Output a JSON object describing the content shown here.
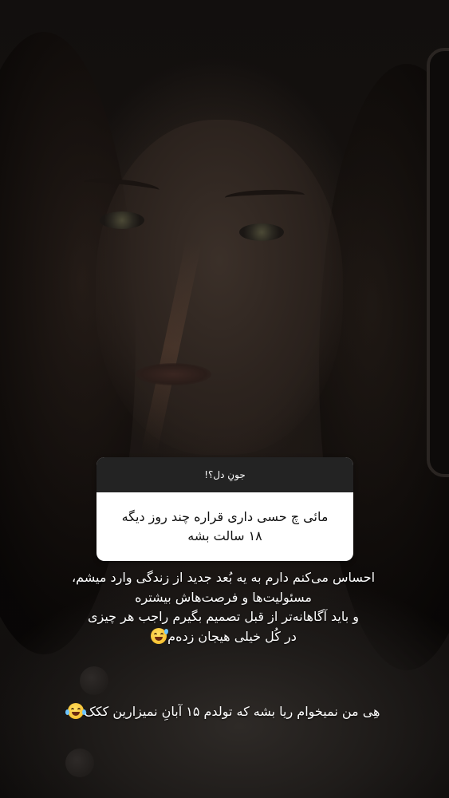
{
  "question_sticker": {
    "header": "جونِ دل؟!",
    "question": "مائی چ حسی داری قراره چند روز دیگه ۱۸ سالت بشه"
  },
  "answer": {
    "lines": [
      "احساس می‌کنم دارم به یه بُعد جدید از زندگی وارد میشم،",
      "مسئولیت‌ها و فرصت‌هاش بیشتره",
      "و باید آگاهانه‌تر از قبل تصمیم بگیرم راجب هر چیزی",
      "در کُل خیلی هیجان زدەم"
    ],
    "emoji": "grinning-sweat-emoji"
  },
  "footer": {
    "text": "هِی من نمیخوام ریا بشه که تولدم ۱۵ آبانِ نمیزارین ککک",
    "emoji": "tears-of-joy-emoji"
  },
  "colors": {
    "sticker_header_bg": "#232323",
    "sticker_body_bg": "#ffffff",
    "text": "#ffffff"
  }
}
